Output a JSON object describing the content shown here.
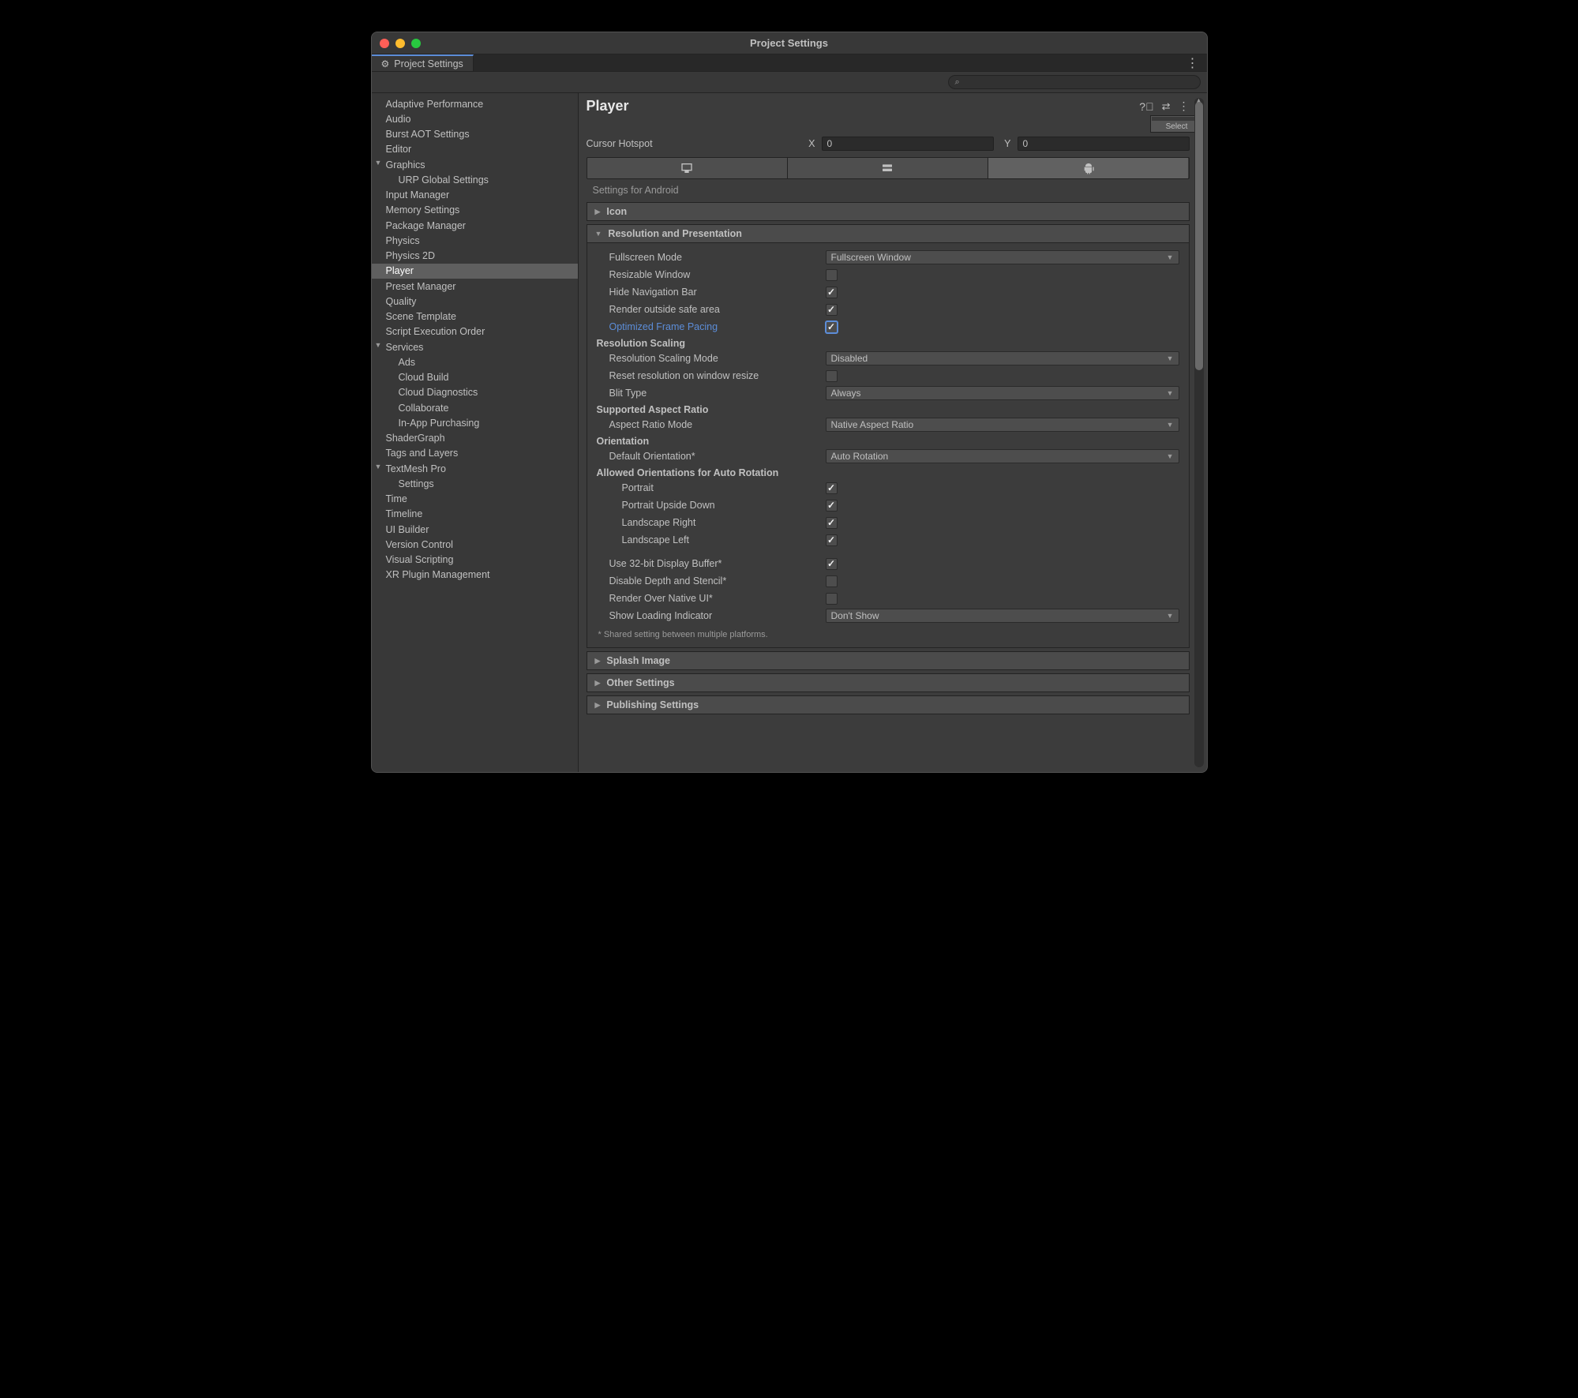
{
  "window": {
    "title": "Project Settings",
    "tab_label": "Project Settings",
    "search_placeholder": ""
  },
  "sidebar": {
    "items": [
      {
        "label": "Adaptive Performance"
      },
      {
        "label": "Audio"
      },
      {
        "label": "Burst AOT Settings"
      },
      {
        "label": "Editor"
      },
      {
        "label": "Graphics",
        "expandable": true,
        "expanded": true
      },
      {
        "label": "URP Global Settings",
        "indent": 1
      },
      {
        "label": "Input Manager"
      },
      {
        "label": "Memory Settings"
      },
      {
        "label": "Package Manager"
      },
      {
        "label": "Physics"
      },
      {
        "label": "Physics 2D"
      },
      {
        "label": "Player",
        "selected": true
      },
      {
        "label": "Preset Manager"
      },
      {
        "label": "Quality"
      },
      {
        "label": "Scene Template"
      },
      {
        "label": "Script Execution Order"
      },
      {
        "label": "Services",
        "expandable": true,
        "expanded": true
      },
      {
        "label": "Ads",
        "indent": 1
      },
      {
        "label": "Cloud Build",
        "indent": 1
      },
      {
        "label": "Cloud Diagnostics",
        "indent": 1
      },
      {
        "label": "Collaborate",
        "indent": 1
      },
      {
        "label": "In-App Purchasing",
        "indent": 1
      },
      {
        "label": "ShaderGraph"
      },
      {
        "label": "Tags and Layers"
      },
      {
        "label": "TextMesh Pro",
        "expandable": true,
        "expanded": true
      },
      {
        "label": "Settings",
        "indent": 1
      },
      {
        "label": "Time"
      },
      {
        "label": "Timeline"
      },
      {
        "label": "UI Builder"
      },
      {
        "label": "Version Control"
      },
      {
        "label": "Visual Scripting"
      },
      {
        "label": "XR Plugin Management"
      }
    ]
  },
  "page": {
    "title": "Player",
    "select_button": "Select",
    "cursor_hotspot_label": "Cursor Hotspot",
    "cursor_hotspot": {
      "x_label": "X",
      "x": "0",
      "y_label": "Y",
      "y": "0"
    },
    "settings_for": "Settings for Android",
    "folds": {
      "icon": "Icon",
      "resolution": "Resolution and Presentation",
      "splash": "Splash Image",
      "other": "Other Settings",
      "publishing": "Publishing Settings"
    },
    "resolution": {
      "fullscreen_mode_label": "Fullscreen Mode",
      "fullscreen_mode": "Fullscreen Window",
      "resizable_window_label": "Resizable Window",
      "resizable_window": false,
      "hide_nav_label": "Hide Navigation Bar",
      "hide_nav": true,
      "render_outside_label": "Render outside safe area",
      "render_outside": true,
      "optimized_frame_label": "Optimized Frame Pacing",
      "optimized_frame": true,
      "scaling_header": "Resolution Scaling",
      "scaling_mode_label": "Resolution Scaling Mode",
      "scaling_mode": "Disabled",
      "reset_res_label": "Reset resolution on window resize",
      "reset_res": false,
      "blit_label": "Blit Type",
      "blit": "Always",
      "aspect_header": "Supported Aspect Ratio",
      "aspect_mode_label": "Aspect Ratio Mode",
      "aspect_mode": "Native Aspect Ratio",
      "orientation_header": "Orientation",
      "default_orientation_label": "Default Orientation*",
      "default_orientation": "Auto Rotation",
      "allowed_header": "Allowed Orientations for Auto Rotation",
      "portrait_label": "Portrait",
      "portrait": true,
      "portrait_ud_label": "Portrait Upside Down",
      "portrait_ud": true,
      "landscape_r_label": "Landscape Right",
      "landscape_r": true,
      "landscape_l_label": "Landscape Left",
      "landscape_l": true,
      "use32_label": "Use 32-bit Display Buffer*",
      "use32": true,
      "disable_depth_label": "Disable Depth and Stencil*",
      "disable_depth": false,
      "render_native_label": "Render Over Native UI*",
      "render_native": false,
      "loading_ind_label": "Show Loading Indicator",
      "loading_ind": "Don't Show",
      "footnote": "* Shared setting between multiple platforms."
    }
  }
}
